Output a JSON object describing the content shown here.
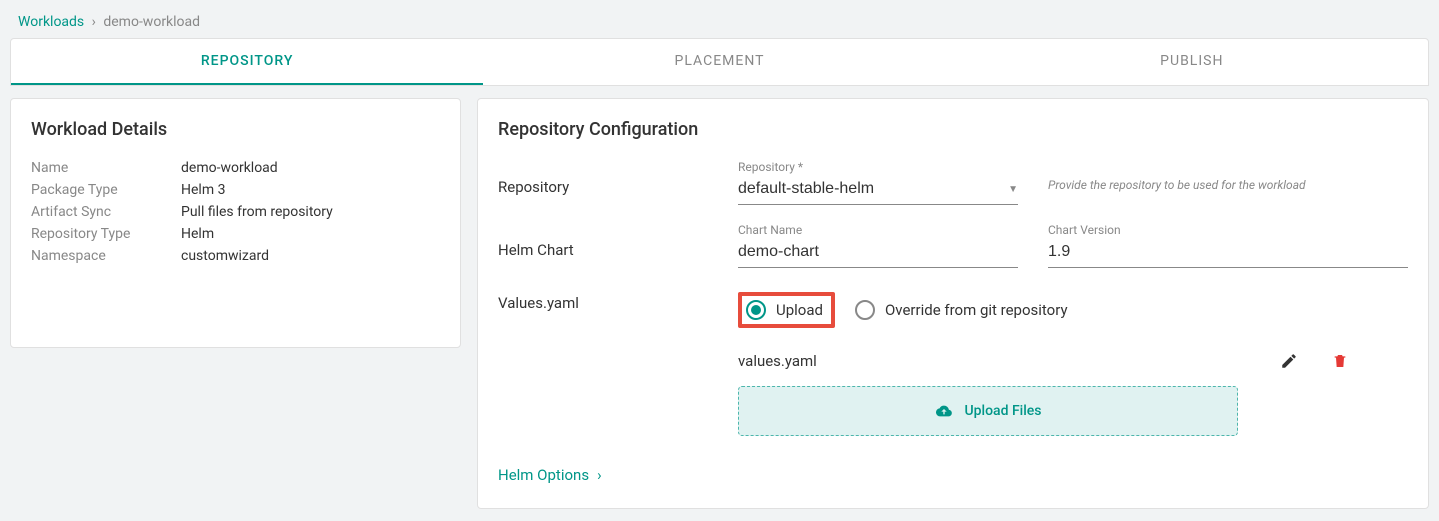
{
  "breadcrumb": {
    "root": "Workloads",
    "current": "demo-workload"
  },
  "tabs": {
    "repository": "REPOSITORY",
    "placement": "PLACEMENT",
    "publish": "PUBLISH"
  },
  "details": {
    "title": "Workload Details",
    "name_label": "Name",
    "name_value": "demo-workload",
    "pkg_label": "Package Type",
    "pkg_value": "Helm 3",
    "sync_label": "Artifact Sync",
    "sync_value": "Pull files from repository",
    "repotype_label": "Repository Type",
    "repotype_value": "Helm",
    "ns_label": "Namespace",
    "ns_value": "customwizard"
  },
  "repo": {
    "title": "Repository Configuration",
    "repo_row_label": "Repository",
    "repo_field_label": "Repository *",
    "repo_value": "default-stable-helm",
    "repo_hint": "Provide the repository to be used for the workload",
    "chart_row_label": "Helm Chart",
    "chartname_label": "Chart Name",
    "chartname_value": "demo-chart",
    "chartver_label": "Chart Version",
    "chartver_value": "1.9",
    "values_label": "Values.yaml",
    "upload_option": "Upload",
    "override_option": "Override from git repository",
    "file_name": "values.yaml",
    "upload_button": "Upload Files",
    "helm_options": "Helm Options"
  }
}
